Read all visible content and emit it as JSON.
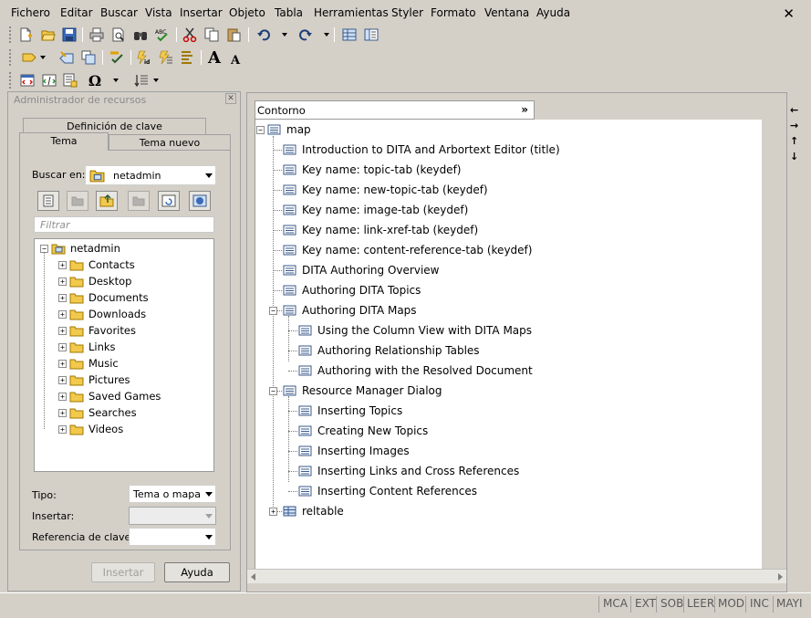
{
  "menu": {
    "items": [
      "Fichero",
      "Editar",
      "Buscar",
      "Vista",
      "Insertar",
      "Objeto",
      "Tabla",
      "Herramientas",
      "Styler",
      "Formato",
      "Ventana",
      "Ayuda"
    ],
    "close_glyph": "✕"
  },
  "toolbar": {
    "row1": [
      "new-document-icon",
      "open-folder-icon",
      "save-icon",
      "print-icon",
      "print-preview-icon",
      "find-icon",
      "spell-check-icon",
      "cut-icon",
      "copy-icon",
      "paste-icon",
      "undo-icon",
      "redo-icon",
      "table-view-icon",
      "document-map-icon"
    ],
    "row2": [
      "markup-icon",
      "insert-markup-icon",
      "insert-element-icon",
      "validate-icon",
      "generate-id-icon",
      "compose-icon",
      "styler-icon",
      "font-size-up-icon",
      "font-size-down-icon"
    ],
    "row3": [
      "xml-tag-icon",
      "xml-edit-icon",
      "document-icon",
      "omega-icon",
      "sort-icon"
    ],
    "font_up_glyph": "A",
    "font_down_glyph": "A",
    "omega_glyph": "Ω"
  },
  "resource_manager": {
    "title": "Administrador de recursos",
    "close_glyph": "✕",
    "tabs": {
      "back_row": "Definición de clave",
      "front_left": "Tema",
      "front_right": "Tema nuevo"
    },
    "search_in_label": "Buscar en:",
    "search_in_value": "netadmin",
    "filter_placeholder": "Filtrar",
    "tree": {
      "root": "netadmin",
      "children": [
        "Contacts",
        "Desktop",
        "Documents",
        "Downloads",
        "Favorites",
        "Links",
        "Music",
        "Pictures",
        "Saved Games",
        "Searches",
        "Videos"
      ]
    },
    "type_label": "Tipo:",
    "type_value": "Tema o mapa",
    "insert_label": "Insertar:",
    "insert_value": "",
    "keyref_label": "Referencia de clave:",
    "keyref_value": "",
    "insert_button": "Insertar",
    "help_button": "Ayuda"
  },
  "outline": {
    "title": "Contorno",
    "chevron": "»",
    "root": "map",
    "items": [
      {
        "label": "Introduction to DITA and Arbortext Editor (title)",
        "level": 1,
        "expander": ""
      },
      {
        "label": "Key name: topic-tab (keydef)",
        "level": 1,
        "expander": ""
      },
      {
        "label": "Key name: new-topic-tab (keydef)",
        "level": 1,
        "expander": ""
      },
      {
        "label": "Key name: image-tab (keydef)",
        "level": 1,
        "expander": ""
      },
      {
        "label": "Key name: link-xref-tab (keydef)",
        "level": 1,
        "expander": ""
      },
      {
        "label": "Key name: content-reference-tab (keydef)",
        "level": 1,
        "expander": ""
      },
      {
        "label": "DITA Authoring Overview",
        "level": 1,
        "expander": ""
      },
      {
        "label": "Authoring DITA Topics",
        "level": 1,
        "expander": ""
      },
      {
        "label": "Authoring DITA Maps",
        "level": 1,
        "expander": "−"
      },
      {
        "label": "Using the Column View with DITA Maps",
        "level": 2,
        "expander": ""
      },
      {
        "label": "Authoring Relationship Tables",
        "level": 2,
        "expander": ""
      },
      {
        "label": "Authoring with the Resolved Document",
        "level": 2,
        "expander": ""
      },
      {
        "label": "Resource Manager Dialog",
        "level": 1,
        "expander": "−"
      },
      {
        "label": "Inserting Topics",
        "level": 2,
        "expander": ""
      },
      {
        "label": "Creating New Topics",
        "level": 2,
        "expander": ""
      },
      {
        "label": "Inserting Images",
        "level": 2,
        "expander": ""
      },
      {
        "label": "Inserting Links and Cross References",
        "level": 2,
        "expander": ""
      },
      {
        "label": "Inserting Content References",
        "level": 2,
        "expander": ""
      },
      {
        "label": "reltable",
        "level": 1,
        "expander": "+"
      }
    ]
  },
  "side_arrows": [
    "←",
    "→",
    "↑",
    "↓"
  ],
  "status": [
    "MCA",
    "EXT",
    "SOB",
    "LEER",
    "MOD",
    "INC",
    "MAYI"
  ]
}
